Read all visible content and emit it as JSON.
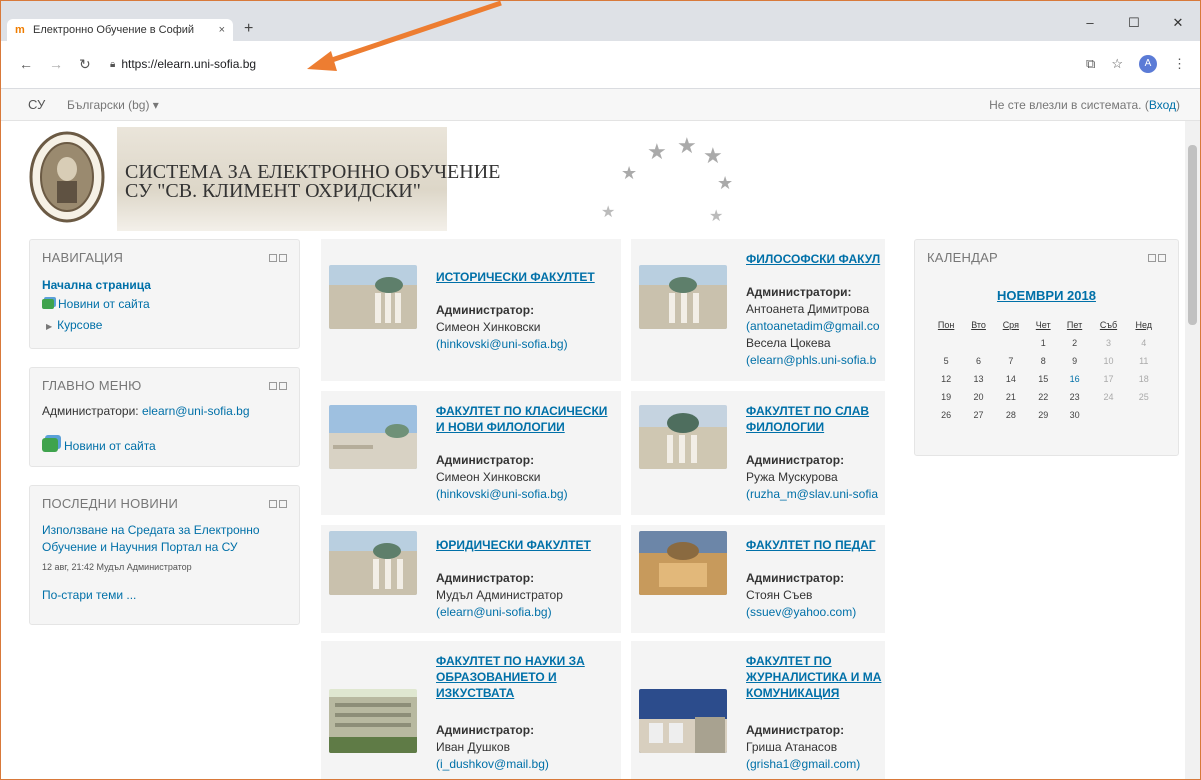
{
  "browser": {
    "tab_title": "Електронно Обучение в Софий",
    "tab_close": "×",
    "new_tab": "+",
    "url": "https://elearn.uni-sofia.bg",
    "avatar_letter": "A",
    "win_min": "–",
    "win_max": "☐",
    "win_close": "✕"
  },
  "topbar": {
    "brand": "СУ",
    "language": "Български (bg) ▾",
    "login_text": "Не сте влезли в системата. (",
    "login_link": "Вход",
    "login_close": ")"
  },
  "banner": {
    "title_line1": "СИСТЕМА ЗА ЕЛЕКТРОННО ОБУЧЕНИЕ",
    "title_line2": "СУ \"СВ. КЛИМЕНТ ОХРИДСКИ\""
  },
  "nav_block": {
    "title": "НАВИГАЦИЯ",
    "home": "Начална страница",
    "site_news": "Новини от сайта",
    "courses": "Курсове"
  },
  "main_menu_block": {
    "title": "ГЛАВНО МЕНЮ",
    "admins_label": "Администратори: ",
    "admins_email": "elearn@uni-sofia.bg",
    "site_news": "Новини от сайта"
  },
  "news_block": {
    "title": "ПОСЛЕДНИ НОВИНИ",
    "item_title": "Използване на Средата за Електронно Обучение и Научния Портал на СУ",
    "item_meta": "12 авг, 21:42 Мудъл Администратор",
    "older": "По-стари теми ..."
  },
  "faculties": [
    {
      "name": "Исторически факултет",
      "label": "Администратор:",
      "admins": [
        "Симеон Хинковски",
        "(hinkovski@uni-sofia.bg)"
      ]
    },
    {
      "name": "Философски факул",
      "label": "Администратори:",
      "admins": [
        "Антоанета Димитрова",
        "(antoanetadim@gmail.co",
        "Весела Цокева",
        "(elearn@phls.uni-sofia.b"
      ]
    },
    {
      "name": "Факултет по класически и нови филологии",
      "label": "Администратор:",
      "admins": [
        "Симеон Хинковски",
        "(hinkovski@uni-sofia.bg)"
      ]
    },
    {
      "name": "Факултет по слав филологии",
      "label": "Администратор:",
      "admins": [
        "Ружа Мускурова",
        "(ruzha_m@slav.uni-sofia"
      ]
    },
    {
      "name": "Юридически факултет",
      "label": "Администратор:",
      "admins": [
        "Мудъл Администратор",
        "(elearn@uni-sofia.bg)"
      ]
    },
    {
      "name": "Факултет по педаг",
      "label": "Администратор:",
      "admins": [
        "Стоян Съев",
        "(ssuev@yahoo.com)"
      ]
    },
    {
      "name": "Факултет по науки за образованието и изкуствата",
      "label": "Администратор:",
      "admins": [
        "Иван Душков",
        "(i_dushkov@mail.bg)"
      ]
    },
    {
      "name": "Факултет по журналистика и ма комуникация",
      "label": "Администратор:",
      "admins": [
        "Гриша Атанасов",
        "(grisha1@gmail.com)"
      ]
    }
  ],
  "calendar": {
    "title": "КАЛЕНДАР",
    "month": "НОЕМВРИ 2018",
    "weekdays": [
      "Пон",
      "Вто",
      "Сря",
      "Чет",
      "Пет",
      "Съб",
      "Нед"
    ],
    "weeks": [
      [
        "",
        "",
        "",
        "1",
        "2",
        "3",
        "4"
      ],
      [
        "5",
        "6",
        "7",
        "8",
        "9",
        "10",
        "11"
      ],
      [
        "12",
        "13",
        "14",
        "15",
        "16",
        "17",
        "18"
      ],
      [
        "19",
        "20",
        "21",
        "22",
        "23",
        "24",
        "25"
      ],
      [
        "26",
        "27",
        "28",
        "29",
        "30",
        "",
        ""
      ]
    ],
    "today": "16"
  }
}
